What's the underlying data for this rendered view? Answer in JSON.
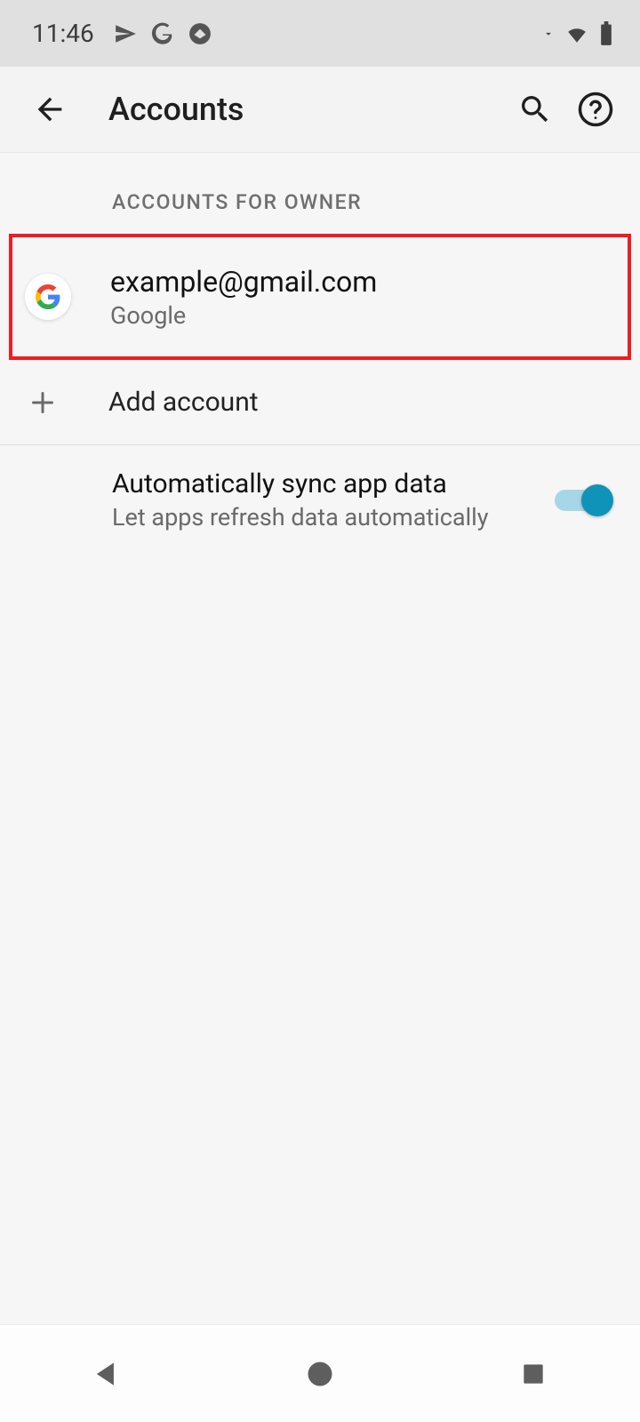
{
  "status_bar": {
    "time": "11:46"
  },
  "app_bar": {
    "title": "Accounts"
  },
  "section_header": "ACCOUNTS FOR OWNER",
  "account": {
    "email": "example@gmail.com",
    "provider": "Google"
  },
  "add_account_label": "Add account",
  "sync": {
    "title": "Automatically sync app data",
    "subtitle": "Let apps refresh data automatically",
    "enabled": true
  },
  "colors": {
    "highlight_border": "#ee1c25",
    "toggle_thumb": "#0f93b8",
    "toggle_track": "#a6d7e6"
  }
}
